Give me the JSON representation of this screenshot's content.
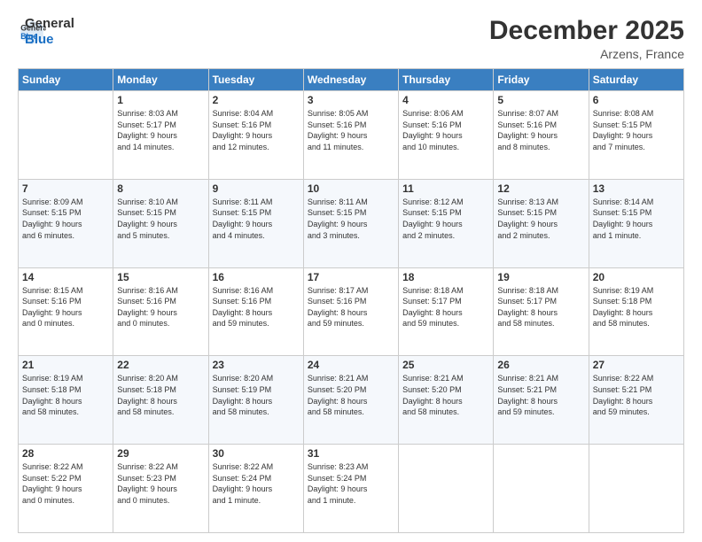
{
  "logo": {
    "line1": "General",
    "line2": "Blue"
  },
  "title": "December 2025",
  "subtitle": "Arzens, France",
  "header_days": [
    "Sunday",
    "Monday",
    "Tuesday",
    "Wednesday",
    "Thursday",
    "Friday",
    "Saturday"
  ],
  "weeks": [
    [
      {
        "num": "",
        "info": ""
      },
      {
        "num": "1",
        "info": "Sunrise: 8:03 AM\nSunset: 5:17 PM\nDaylight: 9 hours\nand 14 minutes."
      },
      {
        "num": "2",
        "info": "Sunrise: 8:04 AM\nSunset: 5:16 PM\nDaylight: 9 hours\nand 12 minutes."
      },
      {
        "num": "3",
        "info": "Sunrise: 8:05 AM\nSunset: 5:16 PM\nDaylight: 9 hours\nand 11 minutes."
      },
      {
        "num": "4",
        "info": "Sunrise: 8:06 AM\nSunset: 5:16 PM\nDaylight: 9 hours\nand 10 minutes."
      },
      {
        "num": "5",
        "info": "Sunrise: 8:07 AM\nSunset: 5:16 PM\nDaylight: 9 hours\nand 8 minutes."
      },
      {
        "num": "6",
        "info": "Sunrise: 8:08 AM\nSunset: 5:15 PM\nDaylight: 9 hours\nand 7 minutes."
      }
    ],
    [
      {
        "num": "7",
        "info": "Sunrise: 8:09 AM\nSunset: 5:15 PM\nDaylight: 9 hours\nand 6 minutes."
      },
      {
        "num": "8",
        "info": "Sunrise: 8:10 AM\nSunset: 5:15 PM\nDaylight: 9 hours\nand 5 minutes."
      },
      {
        "num": "9",
        "info": "Sunrise: 8:11 AM\nSunset: 5:15 PM\nDaylight: 9 hours\nand 4 minutes."
      },
      {
        "num": "10",
        "info": "Sunrise: 8:11 AM\nSunset: 5:15 PM\nDaylight: 9 hours\nand 3 minutes."
      },
      {
        "num": "11",
        "info": "Sunrise: 8:12 AM\nSunset: 5:15 PM\nDaylight: 9 hours\nand 2 minutes."
      },
      {
        "num": "12",
        "info": "Sunrise: 8:13 AM\nSunset: 5:15 PM\nDaylight: 9 hours\nand 2 minutes."
      },
      {
        "num": "13",
        "info": "Sunrise: 8:14 AM\nSunset: 5:15 PM\nDaylight: 9 hours\nand 1 minute."
      }
    ],
    [
      {
        "num": "14",
        "info": "Sunrise: 8:15 AM\nSunset: 5:16 PM\nDaylight: 9 hours\nand 0 minutes."
      },
      {
        "num": "15",
        "info": "Sunrise: 8:16 AM\nSunset: 5:16 PM\nDaylight: 9 hours\nand 0 minutes."
      },
      {
        "num": "16",
        "info": "Sunrise: 8:16 AM\nSunset: 5:16 PM\nDaylight: 8 hours\nand 59 minutes."
      },
      {
        "num": "17",
        "info": "Sunrise: 8:17 AM\nSunset: 5:16 PM\nDaylight: 8 hours\nand 59 minutes."
      },
      {
        "num": "18",
        "info": "Sunrise: 8:18 AM\nSunset: 5:17 PM\nDaylight: 8 hours\nand 59 minutes."
      },
      {
        "num": "19",
        "info": "Sunrise: 8:18 AM\nSunset: 5:17 PM\nDaylight: 8 hours\nand 58 minutes."
      },
      {
        "num": "20",
        "info": "Sunrise: 8:19 AM\nSunset: 5:18 PM\nDaylight: 8 hours\nand 58 minutes."
      }
    ],
    [
      {
        "num": "21",
        "info": "Sunrise: 8:19 AM\nSunset: 5:18 PM\nDaylight: 8 hours\nand 58 minutes."
      },
      {
        "num": "22",
        "info": "Sunrise: 8:20 AM\nSunset: 5:18 PM\nDaylight: 8 hours\nand 58 minutes."
      },
      {
        "num": "23",
        "info": "Sunrise: 8:20 AM\nSunset: 5:19 PM\nDaylight: 8 hours\nand 58 minutes."
      },
      {
        "num": "24",
        "info": "Sunrise: 8:21 AM\nSunset: 5:20 PM\nDaylight: 8 hours\nand 58 minutes."
      },
      {
        "num": "25",
        "info": "Sunrise: 8:21 AM\nSunset: 5:20 PM\nDaylight: 8 hours\nand 58 minutes."
      },
      {
        "num": "26",
        "info": "Sunrise: 8:21 AM\nSunset: 5:21 PM\nDaylight: 8 hours\nand 59 minutes."
      },
      {
        "num": "27",
        "info": "Sunrise: 8:22 AM\nSunset: 5:21 PM\nDaylight: 8 hours\nand 59 minutes."
      }
    ],
    [
      {
        "num": "28",
        "info": "Sunrise: 8:22 AM\nSunset: 5:22 PM\nDaylight: 9 hours\nand 0 minutes."
      },
      {
        "num": "29",
        "info": "Sunrise: 8:22 AM\nSunset: 5:23 PM\nDaylight: 9 hours\nand 0 minutes."
      },
      {
        "num": "30",
        "info": "Sunrise: 8:22 AM\nSunset: 5:24 PM\nDaylight: 9 hours\nand 1 minute."
      },
      {
        "num": "31",
        "info": "Sunrise: 8:23 AM\nSunset: 5:24 PM\nDaylight: 9 hours\nand 1 minute."
      },
      {
        "num": "",
        "info": ""
      },
      {
        "num": "",
        "info": ""
      },
      {
        "num": "",
        "info": ""
      }
    ]
  ]
}
